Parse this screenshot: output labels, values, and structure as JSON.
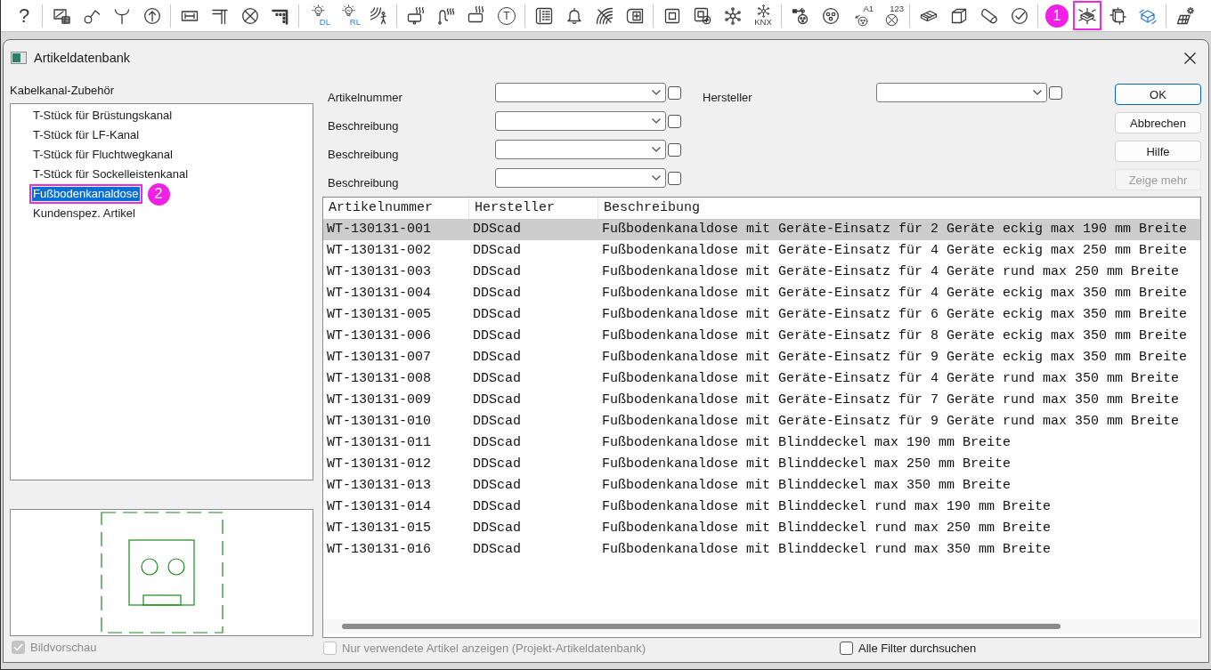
{
  "toolbar": {
    "groups": [
      {
        "items": [
          {
            "kind": "help",
            "label": "?",
            "highlighted": false
          }
        ]
      },
      {
        "items": [
          {
            "kind": "screen",
            "highlighted": false
          },
          {
            "kind": "switch",
            "highlighted": false
          },
          {
            "kind": "antenna",
            "highlighted": false
          },
          {
            "kind": "upload",
            "highlighted": false
          }
        ]
      },
      {
        "items": [
          {
            "kind": "dimension",
            "highlighted": false
          },
          {
            "kind": "wall",
            "highlighted": false
          },
          {
            "kind": "lamp",
            "highlighted": false
          },
          {
            "kind": "corner",
            "highlighted": false
          }
        ]
      },
      {
        "items": [
          {
            "kind": "light",
            "label": "DL",
            "highlighted": false
          },
          {
            "kind": "light",
            "label": "RL",
            "highlighted": false
          },
          {
            "kind": "motion",
            "highlighted": false
          }
        ]
      },
      {
        "items": [
          {
            "kind": "heater",
            "highlighted": false
          },
          {
            "kind": "pipe_heater",
            "highlighted": false
          },
          {
            "kind": "radiator",
            "highlighted": false
          },
          {
            "kind": "thermostat",
            "label": "T",
            "highlighted": false
          }
        ]
      },
      {
        "items": [
          {
            "kind": "intercom",
            "highlighted": false
          },
          {
            "kind": "bell",
            "highlighted": false
          },
          {
            "kind": "signal",
            "highlighted": false
          },
          {
            "kind": "socket_plus",
            "highlighted": false
          }
        ]
      },
      {
        "items": [
          {
            "kind": "socket",
            "highlighted": false
          },
          {
            "kind": "socket_add",
            "highlighted": false
          },
          {
            "kind": "network",
            "highlighted": false
          },
          {
            "kind": "network",
            "label": "KNX",
            "highlighted": false
          }
        ]
      },
      {
        "items": [
          {
            "kind": "split",
            "highlighted": false
          },
          {
            "kind": "outlet",
            "highlighted": false
          },
          {
            "kind": "assign",
            "label": "A1",
            "highlighted": false
          },
          {
            "kind": "numbering",
            "label": "123",
            "highlighted": false
          }
        ]
      },
      {
        "items": [
          {
            "kind": "tray",
            "highlighted": false
          },
          {
            "kind": "duct",
            "highlighted": false
          },
          {
            "kind": "tube",
            "highlighted": false
          },
          {
            "kind": "check",
            "highlighted": false
          }
        ]
      },
      {
        "items": [
          {
            "kind": "floorbox",
            "marker": "1",
            "highlighted": true
          },
          {
            "kind": "box",
            "highlighted": false
          },
          {
            "kind": "channel",
            "highlighted": false
          }
        ]
      },
      {
        "items": [
          {
            "kind": "solar",
            "highlighted": false
          }
        ]
      }
    ]
  },
  "dialog": {
    "title": "Artikeldatenbank"
  },
  "category": {
    "title": "Kabelkanal-Zubehör",
    "items": [
      {
        "label": "T-Stück für Brüstungskanal",
        "selected": false,
        "highlighted": false
      },
      {
        "label": "T-Stück für LF-Kanal",
        "selected": false,
        "highlighted": false
      },
      {
        "label": "T-Stück für Fluchtwegkanal",
        "selected": false,
        "highlighted": false
      },
      {
        "label": "T-Stück für Sockelleistenkanal",
        "selected": false,
        "highlighted": false
      },
      {
        "label": "Fußbodenkanaldose",
        "selected": true,
        "highlighted": true,
        "marker": "2"
      },
      {
        "label": "Kundenspez. Artikel",
        "selected": false,
        "highlighted": false
      }
    ]
  },
  "preview": {
    "label": "Bildvorschau",
    "checked": true,
    "disabled": true
  },
  "filters": [
    {
      "label": "Artikelnummer",
      "checked": false
    },
    {
      "label": "Beschreibung",
      "checked": false
    },
    {
      "label": "Beschreibung",
      "checked": false
    },
    {
      "label": "Beschreibung",
      "checked": false
    }
  ],
  "manufacturer_filter": {
    "label": "Hersteller",
    "checked": false
  },
  "buttons": [
    {
      "label": "OK",
      "default": true,
      "disabled": false
    },
    {
      "label": "Abbrechen",
      "default": false,
      "disabled": false
    },
    {
      "label": "Hilfe",
      "default": false,
      "disabled": false
    },
    {
      "label": "Zeige mehr",
      "default": false,
      "disabled": true
    }
  ],
  "table": {
    "columns": [
      "Artikelnummer",
      "Hersteller",
      "Beschreibung"
    ],
    "rows": [
      {
        "cells": [
          "WT-130131-001",
          "DDScad",
          "Fußbodenkanaldose mit Geräte-Einsatz für 2 Geräte eckig max 190 mm Breite"
        ],
        "selected": true
      },
      {
        "cells": [
          "WT-130131-002",
          "DDScad",
          "Fußbodenkanaldose mit Geräte-Einsatz für 4 Geräte eckig max 250 mm Breite"
        ],
        "selected": false
      },
      {
        "cells": [
          "WT-130131-003",
          "DDScad",
          "Fußbodenkanaldose mit Geräte-Einsatz für 4 Geräte rund max 250 mm Breite"
        ],
        "selected": false
      },
      {
        "cells": [
          "WT-130131-004",
          "DDScad",
          "Fußbodenkanaldose mit Geräte-Einsatz für 4 Geräte eckig max 350 mm Breite"
        ],
        "selected": false
      },
      {
        "cells": [
          "WT-130131-005",
          "DDScad",
          "Fußbodenkanaldose mit Geräte-Einsatz für 6 Geräte eckig max 350 mm Breite"
        ],
        "selected": false
      },
      {
        "cells": [
          "WT-130131-006",
          "DDScad",
          "Fußbodenkanaldose mit Geräte-Einsatz für 8 Geräte eckig max 350 mm Breite"
        ],
        "selected": false
      },
      {
        "cells": [
          "WT-130131-007",
          "DDScad",
          "Fußbodenkanaldose mit Geräte-Einsatz für 9 Geräte eckig max 350 mm Breite"
        ],
        "selected": false
      },
      {
        "cells": [
          "WT-130131-008",
          "DDScad",
          "Fußbodenkanaldose mit Geräte-Einsatz für 4 Geräte rund max 350 mm Breite"
        ],
        "selected": false
      },
      {
        "cells": [
          "WT-130131-009",
          "DDScad",
          "Fußbodenkanaldose mit Geräte-Einsatz für 7 Geräte rund max 350 mm Breite"
        ],
        "selected": false
      },
      {
        "cells": [
          "WT-130131-010",
          "DDScad",
          "Fußbodenkanaldose mit Geräte-Einsatz für 9 Geräte rund max 350 mm Breite"
        ],
        "selected": false
      },
      {
        "cells": [
          "WT-130131-011",
          "DDScad",
          "Fußbodenkanaldose mit Blinddeckel max 190 mm Breite"
        ],
        "selected": false
      },
      {
        "cells": [
          "WT-130131-012",
          "DDScad",
          "Fußbodenkanaldose mit Blinddeckel max 250 mm Breite"
        ],
        "selected": false
      },
      {
        "cells": [
          "WT-130131-013",
          "DDScad",
          "Fußbodenkanaldose mit Blinddeckel max 350 mm Breite"
        ],
        "selected": false
      },
      {
        "cells": [
          "WT-130131-014",
          "DDScad",
          "Fußbodenkanaldose mit Blinddeckel rund max 190 mm Breite"
        ],
        "selected": false
      },
      {
        "cells": [
          "WT-130131-015",
          "DDScad",
          "Fußbodenkanaldose mit Blinddeckel rund max 250 mm Breite"
        ],
        "selected": false
      },
      {
        "cells": [
          "WT-130131-016",
          "DDScad",
          "Fußbodenkanaldose mit Blinddeckel rund max 350 mm Breite"
        ],
        "selected": false
      }
    ]
  },
  "options": [
    {
      "label": "Nur verwendete Artikel anzeigen (Projekt-Artikeldatenbank)",
      "checked": false,
      "disabled": true
    },
    {
      "label": "Alle Filter durchsuchen",
      "checked": false,
      "disabled": false
    }
  ]
}
